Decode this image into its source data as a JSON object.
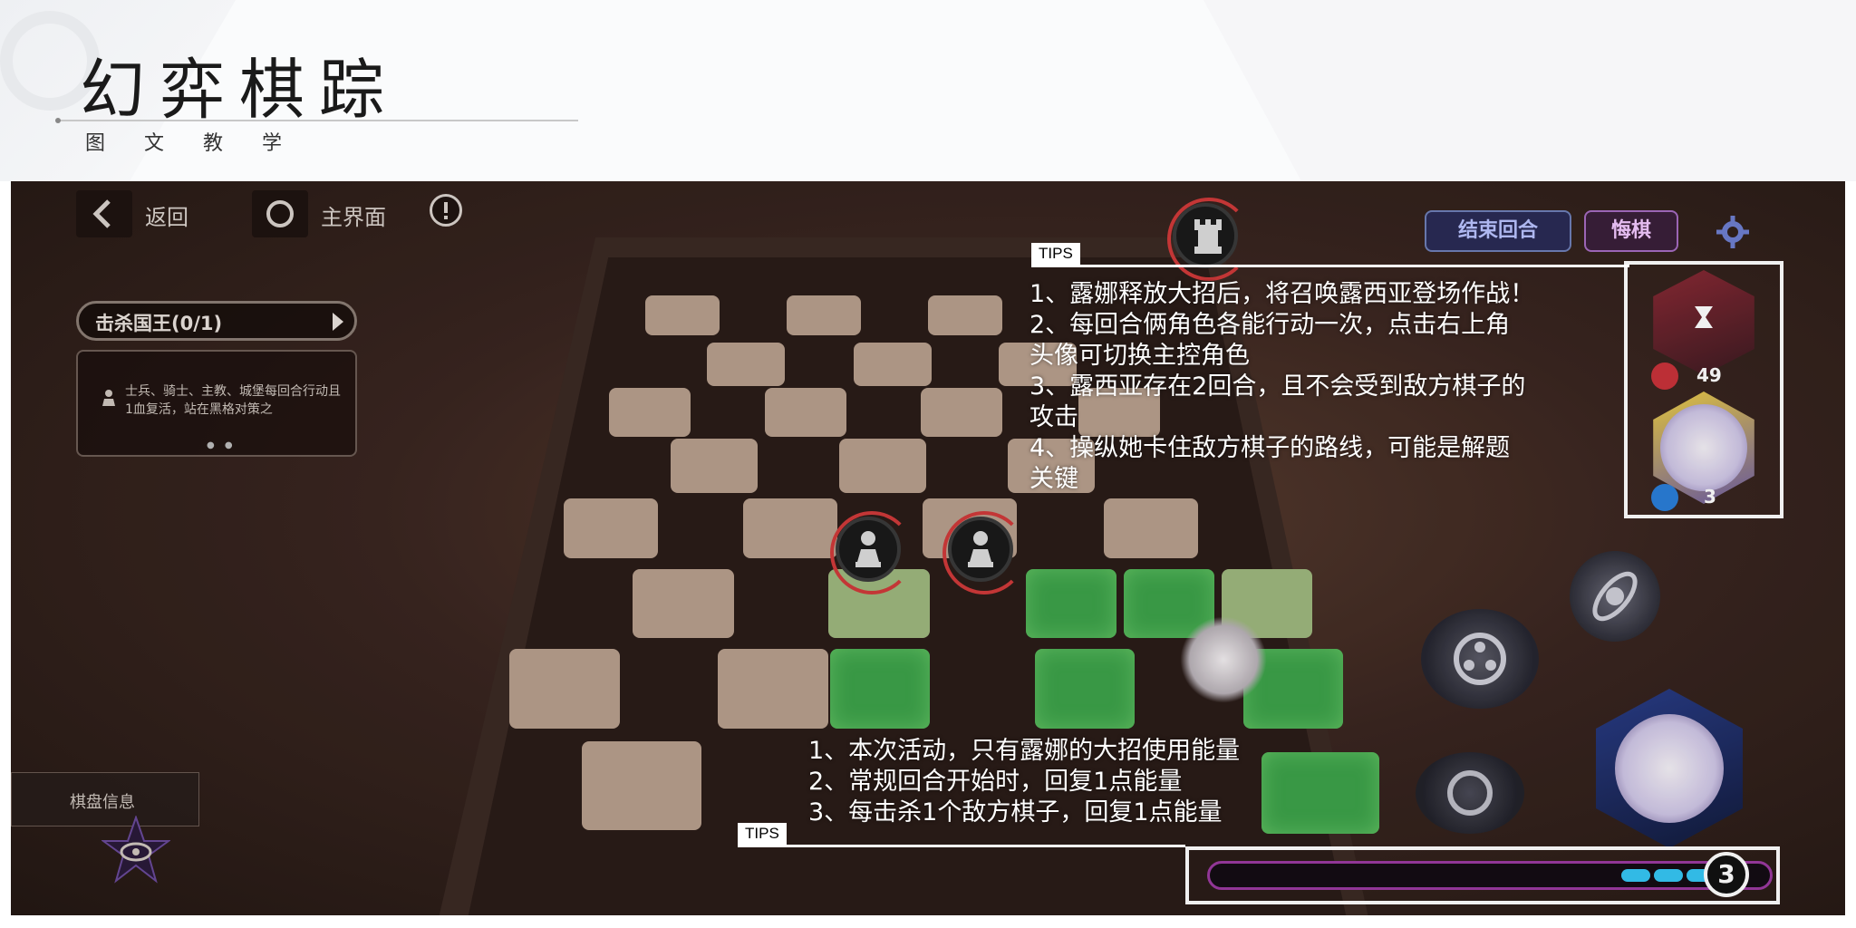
{
  "header": {
    "title": "幻弈棋踪",
    "subtitle": "图 文 教 学"
  },
  "game": {
    "back_label": "返回",
    "home_label": "主界面",
    "info_icon": "info-icon",
    "quest_title": "击杀国王(0/1)",
    "quest_desc": "士兵、骑士、主教、城堡每回合行动且1血复活，站在黑格对策之",
    "end_turn_label": "结束回合",
    "undo_label": "悔棋",
    "board_info_label": "棋盘信息",
    "lucia_hp": "49",
    "luna_skill_count": "3",
    "energy_value": "3",
    "energy_pips": 3,
    "colors": {
      "accent_green": "#3da24a",
      "energy_blue": "#36c6f4",
      "energy_border": "#9b3aa0"
    }
  },
  "tips_top": {
    "label": "TIPS",
    "lines": [
      "1、露娜释放大招后，将召唤露西亚登场作战！",
      "2、每回合俩角色各能行动一次，点击右上角",
      "头像可切换主控角色",
      "3、露西亚存在2回合，且不会受到敌方棋子的",
      "攻击",
      "4、操纵她卡住敌方棋子的路线，可能是解题",
      "关键"
    ]
  },
  "tips_bottom": {
    "label": "TIPS",
    "lines": [
      "1、本次活动，只有露娜的大招使用能量",
      "2、常规回合开始时，回复1点能量",
      "3、每击杀1个敌方棋子，回复1点能量"
    ]
  }
}
